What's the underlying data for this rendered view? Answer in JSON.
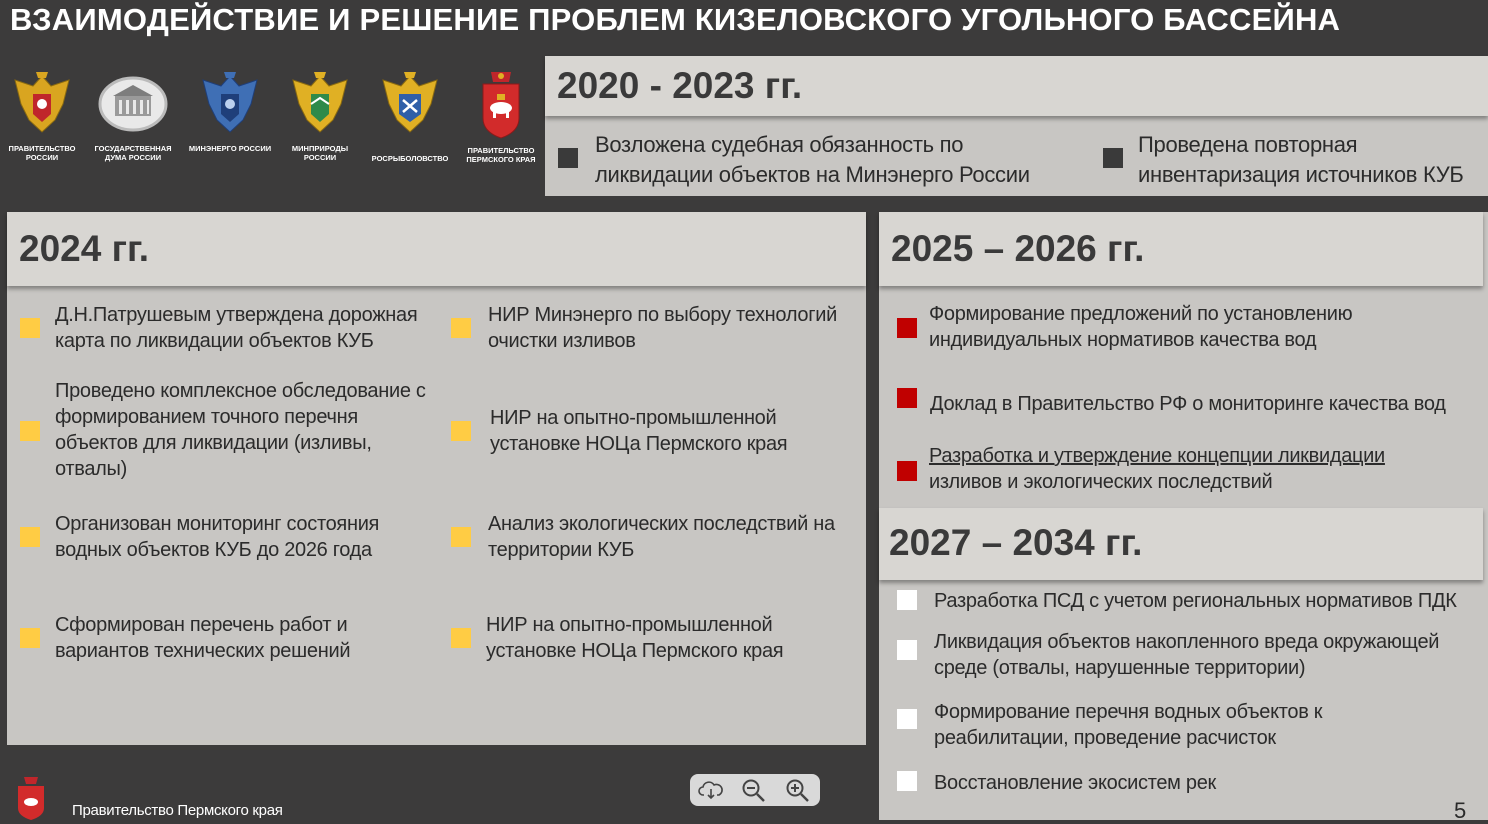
{
  "title": "ВЗАИМОДЕЙСТВИЕ И РЕШЕНИЕ ПРОБЛЕМ КИЗЕЛОВСКОГО УГОЛЬНОГО БАССЕЙНА",
  "logos": [
    {
      "caption": "ПРАВИТЕЛЬСТВО РОССИИ",
      "icon": "russian-eagle-emblem"
    },
    {
      "caption": "ГОСУДАРСТВЕННАЯ ДУМА РОССИИ",
      "icon": "duma-building-emblem"
    },
    {
      "caption": "МИНЭНЕРГО РОССИИ",
      "icon": "blue-eagle-emblem"
    },
    {
      "caption": "МИНПРИРОДЫ РОССИИ",
      "icon": "gold-eagle-emblem"
    },
    {
      "caption": "РОСРЫБОЛОВСТВО",
      "icon": "fishery-eagle-emblem"
    },
    {
      "caption": "ПРАВИТЕЛЬСТВО ПЕРМСКОГО КРАЯ",
      "icon": "perm-krai-emblem"
    }
  ],
  "period_2020": {
    "heading": "2020 - 2023 гг.",
    "items": [
      "Возложена судебная обязанность по ликвидации объектов на Минэнерго России",
      "Проведена повторная инвентаризация источников КУБ"
    ],
    "bullet_color": "#3a3a3a"
  },
  "period_2024": {
    "heading": "2024 гг.",
    "left": [
      "Д.Н.Патрушевым утверждена дорожная карта по ликвидации объектов КУБ",
      "Проведено комплексное обследование с формированием точного перечня объектов для ликвидации (изливы, отвалы)",
      "Организован мониторинг состояния водных объектов КУБ до 2026 года",
      "Сформирован перечень работ и вариантов технических решений"
    ],
    "right": [
      "НИР Минэнерго по выбору технологий очистки изливов",
      "НИР на опытно-промышленной установке НОЦа Пермского края",
      "Анализ экологических последствий на территории КУБ",
      "НИР на опытно-промышленной установке НОЦа Пермского края"
    ],
    "bullet_color": "#ffcc44"
  },
  "period_2025": {
    "heading": "2025 – 2026 гг.",
    "items": [
      "Формирование предложений по установлению индивидуальных нормативов качества вод",
      "Доклад в Правительство РФ о мониторинге качества вод"
    ],
    "underlined_part": "Разработка и утверждение концепции ликвидации",
    "underlined_rest": "изливов и экологических последствий",
    "bullet_color": "#c00000"
  },
  "period_2027": {
    "heading": "2027 – 2034 гг.",
    "items": [
      "Разработка ПСД с учетом региональных нормативов ПДК",
      "Ликвидация объектов накопленного вреда окружающей среде (отвалы, нарушенные территории)",
      "Формирование перечня водных объектов к реабилитации, проведение расчисток",
      "Восстановление экосистем рек"
    ],
    "bullet_color": "#ffffff"
  },
  "toolbar": {
    "buttons": [
      "cloud-download-icon",
      "zoom-out-icon",
      "zoom-in-icon"
    ]
  },
  "footer": {
    "text": "Правительство Пермского края",
    "page_number": "5"
  },
  "colors": {
    "background": "#3c3b3b",
    "panel": "#c8c6c3",
    "panel_header": "#d8d6d2"
  }
}
